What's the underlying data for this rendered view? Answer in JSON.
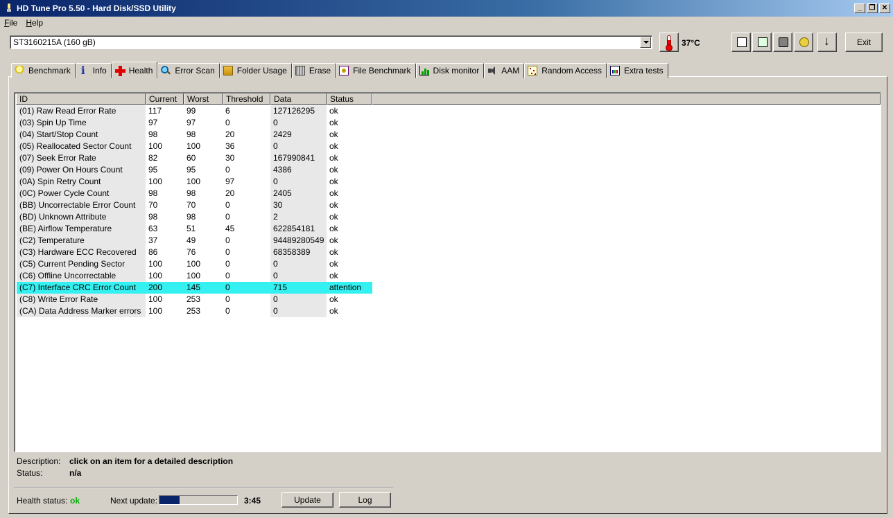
{
  "window": {
    "title": "HD Tune Pro 5.50 - Hard Disk/SSD Utility"
  },
  "menu": [
    "File",
    "Help"
  ],
  "toolbar": {
    "drive": "ST3160215A (160 gB)",
    "temperature": "37°C",
    "exit_label": "Exit"
  },
  "tabs": [
    {
      "label": "Benchmark",
      "icon": "bulb-icon"
    },
    {
      "label": "Info",
      "icon": "info-icon"
    },
    {
      "label": "Health",
      "icon": "health-cross-icon",
      "active": true
    },
    {
      "label": "Error Scan",
      "icon": "magnifier-icon"
    },
    {
      "label": "Folder Usage",
      "icon": "folder-icon"
    },
    {
      "label": "Erase",
      "icon": "erase-icon"
    },
    {
      "label": "File Benchmark",
      "icon": "file-benchmark-icon"
    },
    {
      "label": "Disk monitor",
      "icon": "disk-monitor-icon"
    },
    {
      "label": "AAM",
      "icon": "speaker-icon"
    },
    {
      "label": "Random Access",
      "icon": "random-access-icon"
    },
    {
      "label": "Extra tests",
      "icon": "extra-tests-icon"
    }
  ],
  "table": {
    "columns": [
      "ID",
      "Current",
      "Worst",
      "Threshold",
      "Data",
      "Status"
    ],
    "rows": [
      [
        "(01) Raw Read Error Rate",
        "117",
        "99",
        "6",
        "127126295",
        "ok"
      ],
      [
        "(03) Spin Up Time",
        "97",
        "97",
        "0",
        "0",
        "ok"
      ],
      [
        "(04) Start/Stop Count",
        "98",
        "98",
        "20",
        "2429",
        "ok"
      ],
      [
        "(05) Reallocated Sector Count",
        "100",
        "100",
        "36",
        "0",
        "ok"
      ],
      [
        "(07) Seek Error Rate",
        "82",
        "60",
        "30",
        "167990841",
        "ok"
      ],
      [
        "(09) Power On Hours Count",
        "95",
        "95",
        "0",
        "4386",
        "ok"
      ],
      [
        "(0A) Spin Retry Count",
        "100",
        "100",
        "97",
        "0",
        "ok"
      ],
      [
        "(0C) Power Cycle Count",
        "98",
        "98",
        "20",
        "2405",
        "ok"
      ],
      [
        "(BB) Uncorrectable Error Count",
        "70",
        "70",
        "0",
        "30",
        "ok"
      ],
      [
        "(BD) Unknown Attribute",
        "98",
        "98",
        "0",
        "2",
        "ok"
      ],
      [
        "(BE) Airflow Temperature",
        "63",
        "51",
        "45",
        "622854181",
        "ok"
      ],
      [
        "(C2) Temperature",
        "37",
        "49",
        "0",
        "94489280549",
        "ok"
      ],
      [
        "(C3) Hardware ECC Recovered",
        "86",
        "76",
        "0",
        "68358389",
        "ok"
      ],
      [
        "(C5) Current Pending Sector",
        "100",
        "100",
        "0",
        "0",
        "ok"
      ],
      [
        "(C6) Offline Uncorrectable",
        "100",
        "100",
        "0",
        "0",
        "ok"
      ],
      [
        "(C7) Interface CRC Error Count",
        "200",
        "145",
        "0",
        "715",
        "attention"
      ],
      [
        "(C8) Write Error Rate",
        "100",
        "253",
        "0",
        "0",
        "ok"
      ],
      [
        "(CA) Data Address Marker errors",
        "100",
        "253",
        "0",
        "0",
        "ok"
      ]
    ],
    "selected_row": 15
  },
  "details": {
    "description_label": "Description:",
    "description_value": "click on an item for a detailed description",
    "status_label": "Status:",
    "status_value": "n/a"
  },
  "footer": {
    "health_label": "Health status:",
    "health_value": "ok",
    "health_color": "#00b000",
    "next_update_label": "Next update:",
    "next_update_progress": 0.26,
    "next_update_time": "3:45",
    "update_label": "Update",
    "log_label": "Log"
  },
  "colors": {
    "selection": "#34f0f0",
    "title_bar": "#0a246a"
  }
}
